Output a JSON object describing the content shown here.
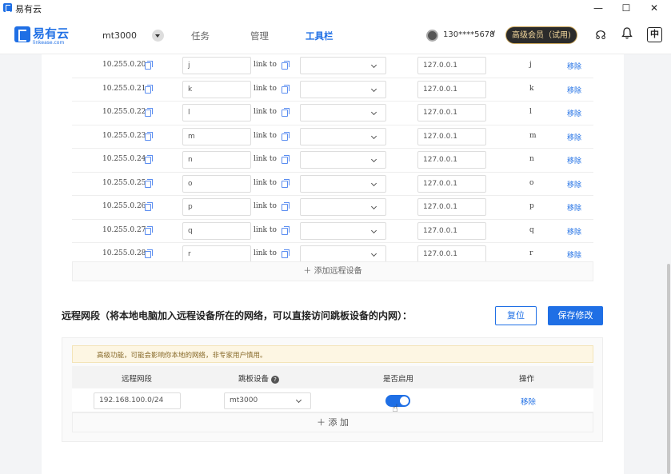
{
  "window": {
    "title": "易有云",
    "minimize": "—",
    "maximize": "☐",
    "close": "✕"
  },
  "nav": {
    "logo_text": "易有云",
    "logo_sub": "linkease.com",
    "device": "mt3000",
    "tabs": [
      {
        "label": "任务",
        "active": false
      },
      {
        "label": "管理",
        "active": false
      },
      {
        "label": "工具栏",
        "active": true
      }
    ],
    "user_phone": "130****5678",
    "user_chevron": "∨",
    "vip_label": "高级会员（试用)",
    "headset_icon": "☊",
    "bell_icon": "♫",
    "lang_label": "中"
  },
  "remote_devices": {
    "rows": [
      {
        "ip": "10.255.0.20",
        "name": "j",
        "link": "link to",
        "local": "127.0.0.1",
        "letter": "j",
        "remove": "移除"
      },
      {
        "ip": "10.255.0.21",
        "name": "k",
        "link": "link to",
        "local": "127.0.0.1",
        "letter": "k",
        "remove": "移除"
      },
      {
        "ip": "10.255.0.22",
        "name": "l",
        "link": "link to",
        "local": "127.0.0.1",
        "letter": "l",
        "remove": "移除"
      },
      {
        "ip": "10.255.0.23",
        "name": "m",
        "link": "link to",
        "local": "127.0.0.1",
        "letter": "m",
        "remove": "移除"
      },
      {
        "ip": "10.255.0.24",
        "name": "n",
        "link": "link to",
        "local": "127.0.0.1",
        "letter": "n",
        "remove": "移除"
      },
      {
        "ip": "10.255.0.25",
        "name": "o",
        "link": "link to",
        "local": "127.0.0.1",
        "letter": "o",
        "remove": "移除"
      },
      {
        "ip": "10.255.0.26",
        "name": "p",
        "link": "link to",
        "local": "127.0.0.1",
        "letter": "p",
        "remove": "移除"
      },
      {
        "ip": "10.255.0.27",
        "name": "q",
        "link": "link to",
        "local": "127.0.0.1",
        "letter": "q",
        "remove": "移除"
      },
      {
        "ip": "10.255.0.28",
        "name": "r",
        "link": "link to",
        "local": "127.0.0.1",
        "letter": "r",
        "remove": "移除"
      }
    ],
    "add_label": "＋ 添加远程设备"
  },
  "segment_section": {
    "title": "远程网段（将本地电脑加入远程设备所在的网络，可以直接访问跳板设备的内网）：",
    "reset_label": "复位",
    "save_label": "保存修改",
    "warning": "高级功能，可能会影响你本地的网络，非专家用户慎用。",
    "headers": {
      "segment": "远程网段",
      "jump": "跳板设备",
      "enabled": "是否启用",
      "action": "操作"
    },
    "help_glyph": "?",
    "row": {
      "segment": "192.168.100.0/24",
      "jump": "mt3000",
      "enabled": true,
      "remove": "移除"
    },
    "add_label": "＋ 添 加"
  },
  "colors": {
    "accent": "#1f6fe5",
    "vip_bg": "#2b2b2b",
    "vip_text": "#f3d79c",
    "warning_bg": "#fdf6e3"
  }
}
